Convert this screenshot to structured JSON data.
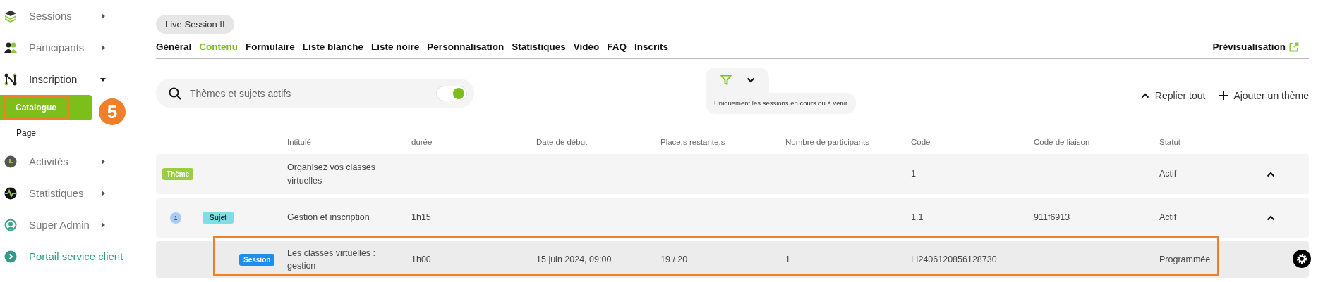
{
  "sidebar": {
    "items": [
      {
        "label": "Sessions",
        "kind": "menu",
        "expanded": false
      },
      {
        "label": "Participants",
        "kind": "menu",
        "expanded": false
      },
      {
        "label": "Inscription",
        "kind": "menu",
        "expanded": true,
        "children": [
          {
            "label": "Catalogue",
            "selected": true,
            "highlighted": true
          },
          {
            "label": "Page",
            "selected": false,
            "highlighted": false
          }
        ]
      },
      {
        "label": "Activités",
        "kind": "menu",
        "expanded": false
      },
      {
        "label": "Statistiques",
        "kind": "menu",
        "expanded": false
      },
      {
        "label": "Super Admin",
        "kind": "menu",
        "expanded": false
      },
      {
        "label": "Portail service client",
        "kind": "link"
      }
    ]
  },
  "step_marker": "5",
  "session_title": "Live Session II",
  "tabs": [
    {
      "label": "Général",
      "selected": false
    },
    {
      "label": "Contenu",
      "selected": true
    },
    {
      "label": "Formulaire",
      "selected": false
    },
    {
      "label": "Liste blanche",
      "selected": false
    },
    {
      "label": "Liste noire",
      "selected": false
    },
    {
      "label": "Personnalisation",
      "selected": false
    },
    {
      "label": "Statistiques",
      "selected": false
    },
    {
      "label": "Vidéo",
      "selected": false
    },
    {
      "label": "FAQ",
      "selected": false
    },
    {
      "label": "Inscrits",
      "selected": false
    }
  ],
  "preview_link": "Prévisualisation",
  "search": {
    "placeholder": "Thèmes et sujets actifs",
    "toggle_on": true
  },
  "filter": {
    "caption": "Uniquement les sessions en cours ou à venir"
  },
  "actions": [
    {
      "label": "Replier tout",
      "kind": "collapse"
    },
    {
      "label": "Ajouter un thème",
      "kind": "add"
    }
  ],
  "table": {
    "columns": [
      "Intitulé",
      "durée",
      "Date de début",
      "Place.s restante.s",
      "Nombre de participants",
      "Code",
      "Code de liaison",
      "Statut"
    ],
    "rows": [
      {
        "kind": "theme",
        "badge": "Thème",
        "cells": [
          "Organisez vos classes virtuelles",
          "",
          "",
          "",
          "",
          "1",
          "",
          "Actif"
        ],
        "expanded": true,
        "highlighted": false
      },
      {
        "kind": "subject",
        "number": "1",
        "badge": "Sujet",
        "cells": [
          "Gestion et inscription",
          "1h15",
          "",
          "",
          "",
          "1.1",
          "911f6913",
          "Actif"
        ],
        "expanded": true,
        "highlighted": false
      },
      {
        "kind": "session",
        "badge": "Session",
        "cells": [
          "Les classes virtuelles : gestion",
          "1h00",
          "15 juin 2024, 09:00",
          "19 / 20",
          "1",
          "LI2406120856128730",
          "",
          "Programmée"
        ],
        "highlighted": true
      }
    ]
  }
}
